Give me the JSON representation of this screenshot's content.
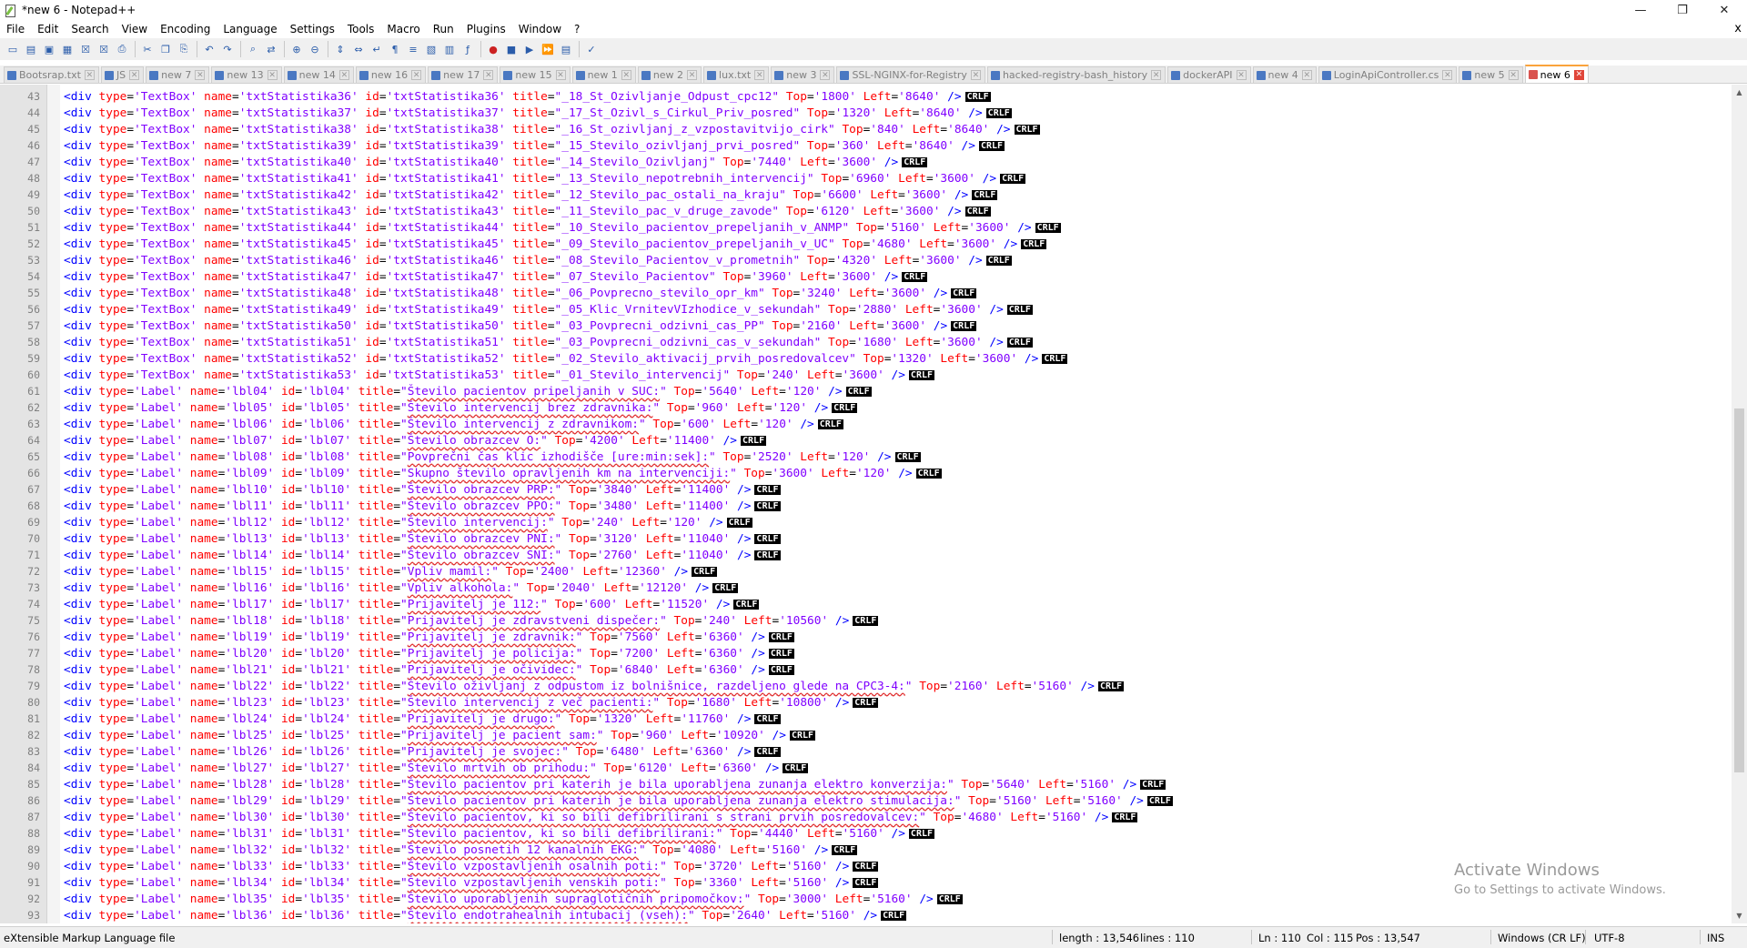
{
  "window": {
    "title": "*new 6 - Notepad++"
  },
  "menu": [
    "File",
    "Edit",
    "Search",
    "View",
    "Encoding",
    "Language",
    "Settings",
    "Tools",
    "Macro",
    "Run",
    "Plugins",
    "Window",
    "?"
  ],
  "menu_close": "x",
  "toolbar_icons": [
    "new-file-icon",
    "open-file-icon",
    "save-icon",
    "save-all-icon",
    "close-icon",
    "close-all-icon",
    "print-icon",
    "sep",
    "cut-icon",
    "copy-icon",
    "paste-icon",
    "sep",
    "undo-icon",
    "redo-icon",
    "sep",
    "find-icon",
    "replace-icon",
    "sep",
    "zoom-in-icon",
    "zoom-out-icon",
    "sep",
    "sync-v-icon",
    "sync-h-icon",
    "word-wrap-icon",
    "show-all-chars-icon",
    "indent-guide-icon",
    "udl-icon",
    "doc-map-icon",
    "function-list-icon",
    "sep",
    "record-macro-icon",
    "stop-record-icon",
    "play-macro-icon",
    "run-macro-multiple-icon",
    "save-macro-icon",
    "sep",
    "spellcheck-icon"
  ],
  "tabs": [
    {
      "label": "Bootsrap.txt",
      "active": false
    },
    {
      "label": "JS",
      "active": false
    },
    {
      "label": "new 7",
      "active": false
    },
    {
      "label": "new 13",
      "active": false
    },
    {
      "label": "new 14",
      "active": false
    },
    {
      "label": "new 16",
      "active": false
    },
    {
      "label": "new 17",
      "active": false
    },
    {
      "label": "new 15",
      "active": false
    },
    {
      "label": "new 1",
      "active": false
    },
    {
      "label": "new 2",
      "active": false
    },
    {
      "label": "lux.txt",
      "active": false
    },
    {
      "label": "new 3",
      "active": false
    },
    {
      "label": "SSL-NGINX-for-Registry",
      "active": false
    },
    {
      "label": "hacked-registry-bash_history",
      "active": false
    },
    {
      "label": "dockerAPI",
      "active": false
    },
    {
      "label": "new 4",
      "active": false
    },
    {
      "label": "LoginApiController.cs",
      "active": false
    },
    {
      "label": "new 5",
      "active": false
    },
    {
      "label": "new 6",
      "active": true
    }
  ],
  "lines": [
    {
      "n": "43",
      "type": "TextBox",
      "name": "txtStatistika36",
      "title": "_18_St_Ozivljanje_Odpust_cpc12",
      "top": "1800",
      "left": "8640"
    },
    {
      "n": "44",
      "type": "TextBox",
      "name": "txtStatistika37",
      "title": "_17_St_Ozivl_s_Cirkul_Priv_posred",
      "top": "1320",
      "left": "8640"
    },
    {
      "n": "45",
      "type": "TextBox",
      "name": "txtStatistika38",
      "title": "_16_St_ozivljanj_z_vzpostavitvijo_cirk",
      "top": "840",
      "left": "8640"
    },
    {
      "n": "46",
      "type": "TextBox",
      "name": "txtStatistika39",
      "title": "_15_Stevilo_ozivljanj_prvi_posred",
      "top": "360",
      "left": "8640"
    },
    {
      "n": "47",
      "type": "TextBox",
      "name": "txtStatistika40",
      "title": "_14_Stevilo_Ozivljanj",
      "top": "7440",
      "left": "3600"
    },
    {
      "n": "48",
      "type": "TextBox",
      "name": "txtStatistika41",
      "title": "_13_Stevilo_nepotrebnih_intervencij",
      "top": "6960",
      "left": "3600"
    },
    {
      "n": "49",
      "type": "TextBox",
      "name": "txtStatistika42",
      "title": "_12_Stevilo_pac_ostali_na_kraju",
      "top": "6600",
      "left": "3600"
    },
    {
      "n": "50",
      "type": "TextBox",
      "name": "txtStatistika43",
      "title": "_11_Stevilo_pac_v_druge_zavode",
      "top": "6120",
      "left": "3600"
    },
    {
      "n": "51",
      "type": "TextBox",
      "name": "txtStatistika44",
      "title": "_10_Stevilo_pacientov_prepeljanih_v_ANMP",
      "top": "5160",
      "left": "3600"
    },
    {
      "n": "52",
      "type": "TextBox",
      "name": "txtStatistika45",
      "title": "_09_Stevilo_pacientov_prepeljanih_v_UC",
      "top": "4680",
      "left": "3600"
    },
    {
      "n": "53",
      "type": "TextBox",
      "name": "txtStatistika46",
      "title": "_08_Stevilo_Pacientov_v_prometnih",
      "top": "4320",
      "left": "3600"
    },
    {
      "n": "54",
      "type": "TextBox",
      "name": "txtStatistika47",
      "title": "_07_Stevilo_Pacientov",
      "top": "3960",
      "left": "3600"
    },
    {
      "n": "55",
      "type": "TextBox",
      "name": "txtStatistika48",
      "title": "_06_Povprecno_stevilo_opr_km",
      "top": "3240",
      "left": "3600"
    },
    {
      "n": "56",
      "type": "TextBox",
      "name": "txtStatistika49",
      "title": "_05_Klic_VrnitevVIzhodice_v_sekundah",
      "top": "2880",
      "left": "3600"
    },
    {
      "n": "57",
      "type": "TextBox",
      "name": "txtStatistika50",
      "title": "_03_Povprecni_odzivni_cas_PP",
      "top": "2160",
      "left": "3600"
    },
    {
      "n": "58",
      "type": "TextBox",
      "name": "txtStatistika51",
      "title": "_03_Povprecni_odzivni_cas_v_sekundah",
      "top": "1680",
      "left": "3600"
    },
    {
      "n": "59",
      "type": "TextBox",
      "name": "txtStatistika52",
      "title": "_02_Stevilo_aktivacij_prvih_posredovalcev",
      "top": "1320",
      "left": "3600"
    },
    {
      "n": "60",
      "type": "TextBox",
      "name": "txtStatistika53",
      "title": "_01_Stevilo_intervencij",
      "top": "240",
      "left": "3600"
    },
    {
      "n": "61",
      "type": "Label",
      "name": "lbl04",
      "title": "Število pacientov pripeljanih v SUC:",
      "top": "5640",
      "left": "120"
    },
    {
      "n": "62",
      "type": "Label",
      "name": "lbl05",
      "title": "Število intervencij brez zdravnika:",
      "top": "960",
      "left": "120"
    },
    {
      "n": "63",
      "type": "Label",
      "name": "lbl06",
      "title": "Število intervencij z zdravnikom:",
      "top": "600",
      "left": "120"
    },
    {
      "n": "64",
      "type": "Label",
      "name": "lbl07",
      "title": "Število obrazcev O:",
      "top": "4200",
      "left": "11400"
    },
    {
      "n": "65",
      "type": "Label",
      "name": "lbl08",
      "title": "Povprečni čas klic izhodišče [ure:min:sek]:",
      "top": "2520",
      "left": "120"
    },
    {
      "n": "66",
      "type": "Label",
      "name": "lbl09",
      "title": "Skupno število opravljenih km na intervenciji:",
      "top": "3600",
      "left": "120"
    },
    {
      "n": "67",
      "type": "Label",
      "name": "lbl10",
      "title": "Število obrazcev PRP:",
      "top": "3840",
      "left": "11400"
    },
    {
      "n": "68",
      "type": "Label",
      "name": "lbl11",
      "title": "Število obrazcev PPO:",
      "top": "3480",
      "left": "11400"
    },
    {
      "n": "69",
      "type": "Label",
      "name": "lbl12",
      "title": "Število intervencij:",
      "top": "240",
      "left": "120"
    },
    {
      "n": "70",
      "type": "Label",
      "name": "lbl13",
      "title": "Število obrazcev PNI:",
      "top": "3120",
      "left": "11040"
    },
    {
      "n": "71",
      "type": "Label",
      "name": "lbl14",
      "title": "Število obrazcev SNI:",
      "top": "2760",
      "left": "11040"
    },
    {
      "n": "72",
      "type": "Label",
      "name": "lbl15",
      "title": "Vpliv mamil:",
      "top": "2400",
      "left": "12360"
    },
    {
      "n": "73",
      "type": "Label",
      "name": "lbl16",
      "title": "Vpliv alkohola:",
      "top": "2040",
      "left": "12120"
    },
    {
      "n": "74",
      "type": "Label",
      "name": "lbl17",
      "title": "Prijavitelj je 112:",
      "top": "600",
      "left": "11520"
    },
    {
      "n": "75",
      "type": "Label",
      "name": "lbl18",
      "title": "Prijavitelj je zdravstveni dispečer:",
      "top": "240",
      "left": "10560"
    },
    {
      "n": "76",
      "type": "Label",
      "name": "lbl19",
      "title": "Prijavitelj je zdravnik:",
      "top": "7560",
      "left": "6360"
    },
    {
      "n": "77",
      "type": "Label",
      "name": "lbl20",
      "title": "Prijavitelj je policija:",
      "top": "7200",
      "left": "6360"
    },
    {
      "n": "78",
      "type": "Label",
      "name": "lbl21",
      "title": "Prijavitelj je očividec:",
      "top": "6840",
      "left": "6360"
    },
    {
      "n": "79",
      "type": "Label",
      "name": "lbl22",
      "title": "Število oživljanj z odpustom iz bolnišnice, razdeljeno glede na CPC3-4:",
      "top": "2160",
      "left": "5160"
    },
    {
      "n": "80",
      "type": "Label",
      "name": "lbl23",
      "title": "Število intervencij z več pacienti:",
      "top": "1680",
      "left": "10800"
    },
    {
      "n": "81",
      "type": "Label",
      "name": "lbl24",
      "title": "Prijavitelj je drugo:",
      "top": "1320",
      "left": "11760"
    },
    {
      "n": "82",
      "type": "Label",
      "name": "lbl25",
      "title": "Prijavitelj je pacient sam:",
      "top": "960",
      "left": "10920"
    },
    {
      "n": "83",
      "type": "Label",
      "name": "lbl26",
      "title": "Prijavitelj je svojec:",
      "top": "6480",
      "left": "6360"
    },
    {
      "n": "84",
      "type": "Label",
      "name": "lbl27",
      "title": "Število mrtvih ob prihodu:",
      "top": "6120",
      "left": "6360"
    },
    {
      "n": "85",
      "type": "Label",
      "name": "lbl28",
      "title": "Število pacientov pri katerih je bila uporabljena zunanja elektro konverzija:",
      "top": "5640",
      "left": "5160"
    },
    {
      "n": "86",
      "type": "Label",
      "name": "lbl29",
      "title": "Število pacientov pri katerih je bila uporabljena zunanja elektro stimulacija:",
      "top": "5160",
      "left": "5160"
    },
    {
      "n": "87",
      "type": "Label",
      "name": "lbl30",
      "title": "Število pacientov, ki so bili defibrilirani s strani prvih posredovalcev:",
      "top": "4680",
      "left": "5160"
    },
    {
      "n": "88",
      "type": "Label",
      "name": "lbl31",
      "title": "Število pacientov, ki so bili defibrilirani:",
      "top": "4440",
      "left": "5160"
    },
    {
      "n": "89",
      "type": "Label",
      "name": "lbl32",
      "title": "Število posnetih 12 kanalnih EKG:",
      "top": "4080",
      "left": "5160"
    },
    {
      "n": "90",
      "type": "Label",
      "name": "lbl33",
      "title": "Število vzpostavljenih osalnih poti:",
      "top": "3720",
      "left": "5160"
    },
    {
      "n": "91",
      "type": "Label",
      "name": "lbl34",
      "title": "Število vzpostavljenih venskih poti:",
      "top": "3360",
      "left": "5160"
    },
    {
      "n": "92",
      "type": "Label",
      "name": "lbl35",
      "title": "Število uporabljenih supraglotičnih pripomočkov:",
      "top": "3000",
      "left": "5160"
    },
    {
      "n": "93",
      "type": "Label",
      "name": "lbl36",
      "title": "Število endotrahealnih intubacij (vseh):",
      "top": "2640",
      "left": "5160"
    }
  ],
  "eol_marker": "CRLF",
  "watermark": {
    "line1": "Activate Windows",
    "line2": "Go to Settings to activate Windows."
  },
  "status": {
    "filetype": "eXtensible Markup Language file",
    "length": "length : 13,546",
    "lines": "lines : 110",
    "ln": "Ln : 110",
    "col": "Col : 115",
    "pos": "Pos : 13,547",
    "eol": "Windows (CR LF)",
    "encoding": "UTF-8",
    "mode": "INS"
  }
}
